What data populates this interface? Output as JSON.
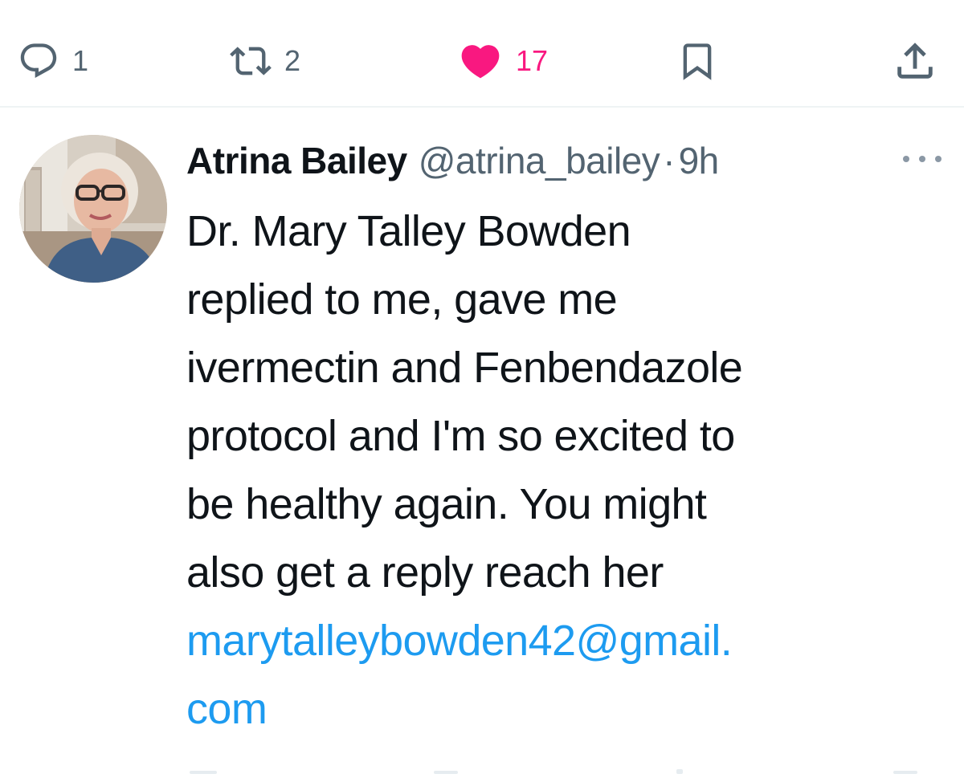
{
  "actions": {
    "reply": {
      "icon": "reply-icon",
      "count": "1"
    },
    "retweet": {
      "icon": "retweet-icon",
      "count": "2"
    },
    "like": {
      "icon": "heart-icon",
      "count": "17",
      "active": true,
      "color": "#f91880"
    },
    "bookmark": {
      "icon": "bookmark-icon"
    },
    "share": {
      "icon": "share-icon"
    }
  },
  "tweet": {
    "author": {
      "display_name": "Atrina Bailey",
      "handle": "@atrina_bailey"
    },
    "separator": "·",
    "timestamp": "9h",
    "more_icon": "more-options-icon",
    "text_lines": [
      "Dr.  Mary Talley Bowden",
      "replied to me, gave me",
      "ivermectin and Fenbendazole",
      "protocol and I'm so excited to",
      "be healthy again. You might",
      "also get a reply reach her"
    ],
    "link_lines": [
      "marytalleybowden42@gmail.",
      "com"
    ]
  },
  "colors": {
    "text_primary": "#0f1419",
    "text_secondary": "#536471",
    "link": "#1d9bf0",
    "like": "#f91880",
    "divider": "#eff3f4"
  }
}
